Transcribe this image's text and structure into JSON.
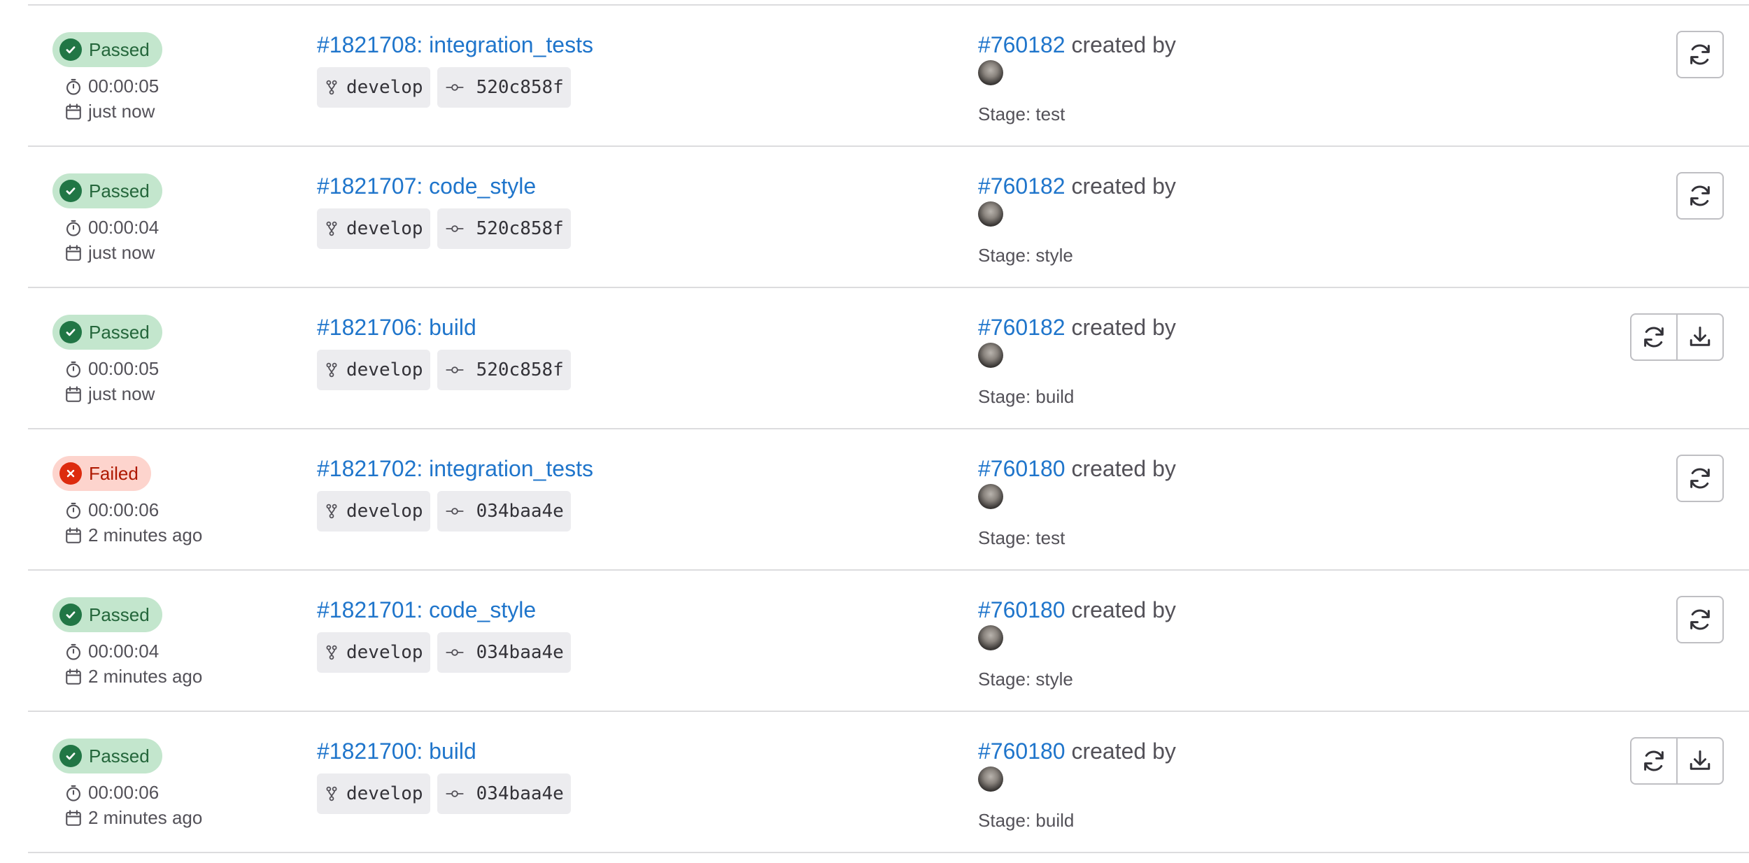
{
  "jobs": [
    {
      "status": "Passed",
      "status_kind": "passed",
      "duration": "00:00:05",
      "finished": "just now",
      "job_label": "#1821708: integration_tests",
      "branch": "develop",
      "commit": "520c858f",
      "pipeline": "#760182",
      "created_by": "created by",
      "stage": "Stage: test",
      "actions": [
        "retry-icon"
      ]
    },
    {
      "status": "Passed",
      "status_kind": "passed",
      "duration": "00:00:04",
      "finished": "just now",
      "job_label": "#1821707: code_style",
      "branch": "develop",
      "commit": "520c858f",
      "pipeline": "#760182",
      "created_by": "created by",
      "stage": "Stage: style",
      "actions": [
        "retry-icon"
      ]
    },
    {
      "status": "Passed",
      "status_kind": "passed",
      "duration": "00:00:05",
      "finished": "just now",
      "job_label": "#1821706: build",
      "branch": "develop",
      "commit": "520c858f",
      "pipeline": "#760182",
      "created_by": "created by",
      "stage": "Stage: build",
      "actions": [
        "retry-icon",
        "download-icon"
      ]
    },
    {
      "status": "Failed",
      "status_kind": "failed",
      "duration": "00:00:06",
      "finished": "2 minutes ago",
      "job_label": "#1821702: integration_tests",
      "branch": "develop",
      "commit": "034baa4e",
      "pipeline": "#760180",
      "created_by": "created by",
      "stage": "Stage: test",
      "actions": [
        "retry-icon"
      ]
    },
    {
      "status": "Passed",
      "status_kind": "passed",
      "duration": "00:00:04",
      "finished": "2 minutes ago",
      "job_label": "#1821701: code_style",
      "branch": "develop",
      "commit": "034baa4e",
      "pipeline": "#760180",
      "created_by": "created by",
      "stage": "Stage: style",
      "actions": [
        "retry-icon"
      ]
    },
    {
      "status": "Passed",
      "status_kind": "passed",
      "duration": "00:00:06",
      "finished": "2 minutes ago",
      "job_label": "#1821700: build",
      "branch": "develop",
      "commit": "034baa4e",
      "pipeline": "#760180",
      "created_by": "created by",
      "stage": "Stage: build",
      "actions": [
        "retry-icon",
        "download-icon"
      ]
    }
  ],
  "colors": {
    "link": "#1f75cb",
    "passed_bg": "#c3e6cd",
    "passed_fg": "#24663b",
    "failed_bg": "#fdd4cd",
    "failed_fg": "#ae1800"
  }
}
